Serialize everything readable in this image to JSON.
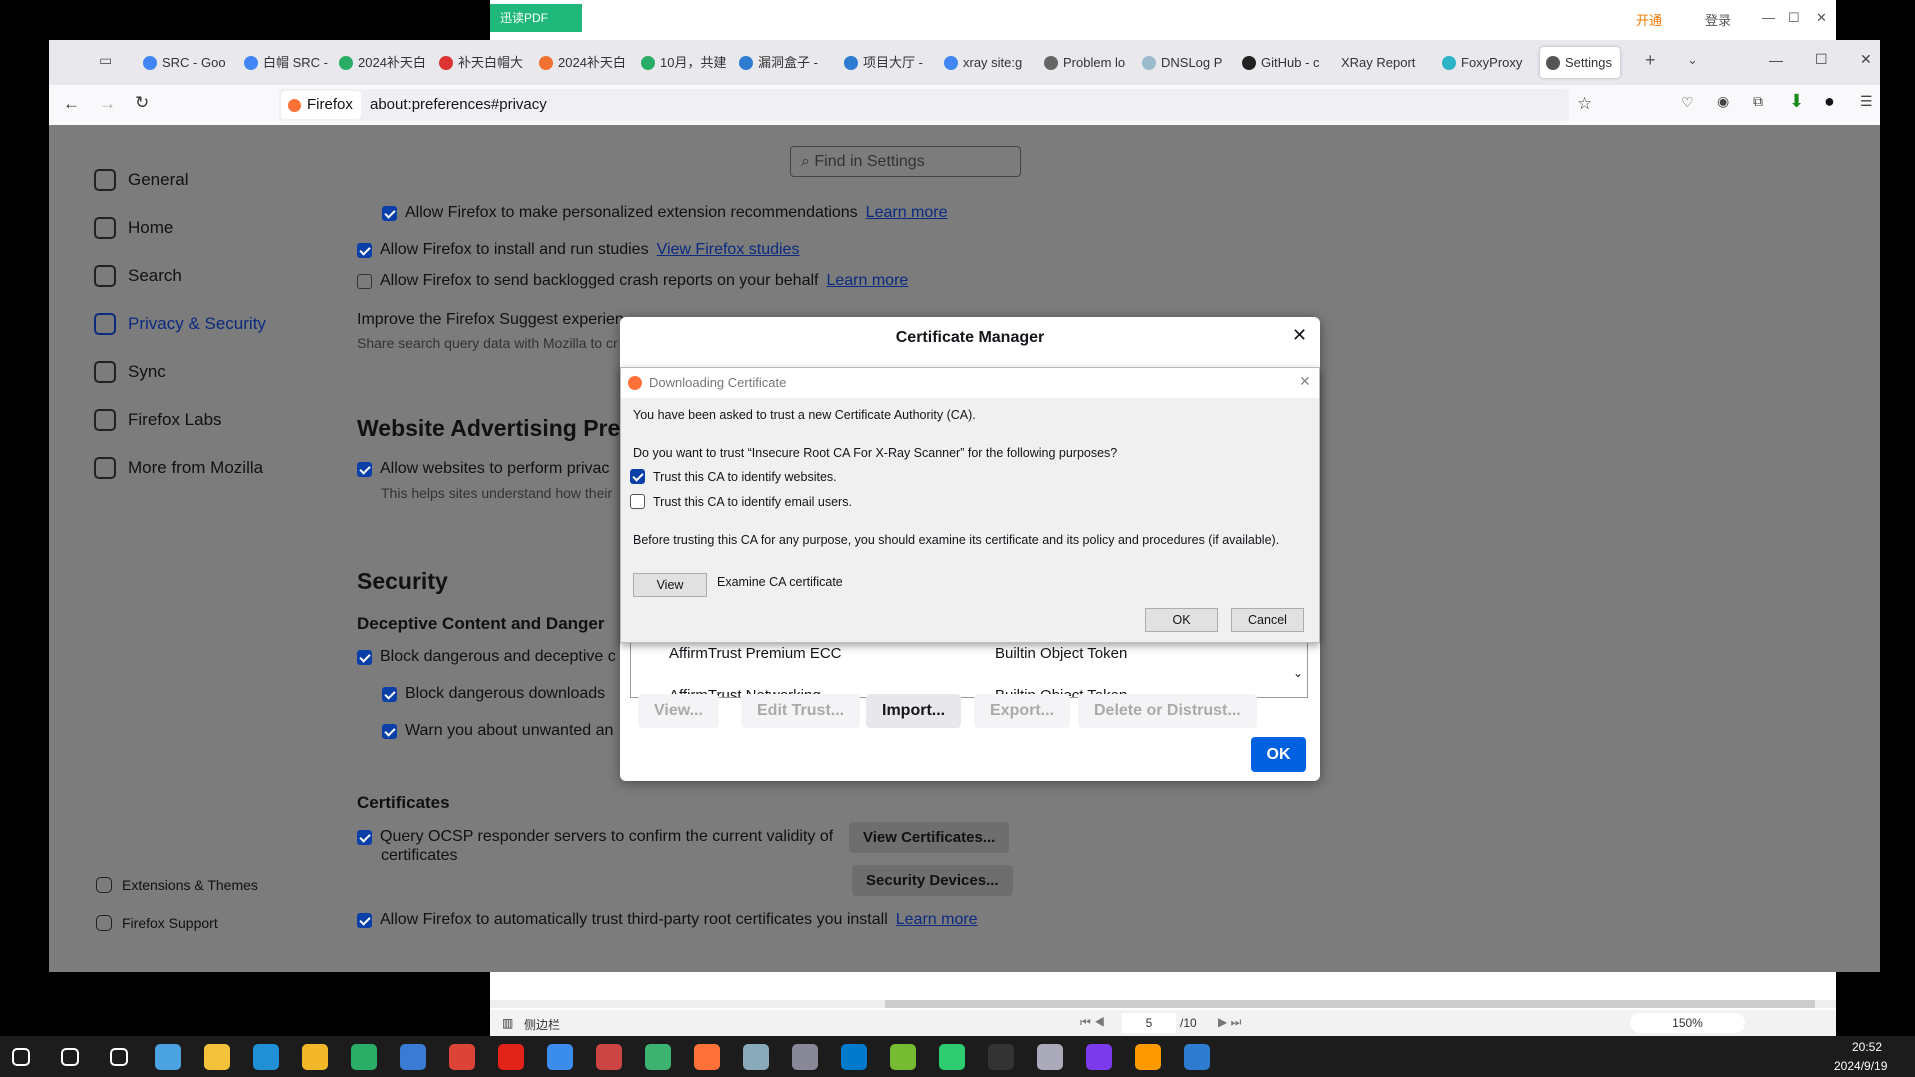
{
  "pdf_app": {
    "badge": "迅读PDF",
    "vip": "开通",
    "login": "登录",
    "sidebar_label": "侧边栏",
    "page_current": "5",
    "page_total": "/10",
    "zoom": "150%"
  },
  "browser": {
    "tabs": [
      {
        "label": "SRC - Goo",
        "icon": "google-icon",
        "color": "#4285f4"
      },
      {
        "label": "白帽 SRC -",
        "icon": "google-icon",
        "color": "#4285f4"
      },
      {
        "label": "2024补天白",
        "icon": "wechat-icon",
        "color": "#2aae67"
      },
      {
        "label": "补天白帽大",
        "icon": "star-icon",
        "color": "#d33"
      },
      {
        "label": "2024补天白",
        "icon": "app-icon",
        "color": "#f07030"
      },
      {
        "label": "10月，共建",
        "icon": "wechat-icon",
        "color": "#2aae67"
      },
      {
        "label": "漏洞盒子 -",
        "icon": "shield-icon",
        "color": "#2d7cd1"
      },
      {
        "label": "项目大厅 -",
        "icon": "shield-icon",
        "color": "#2d7cd1"
      },
      {
        "label": "xray site:g",
        "icon": "google-icon",
        "color": "#4285f4"
      },
      {
        "label": "Problem lo",
        "icon": "info-icon",
        "color": "#666"
      },
      {
        "label": "DNSLog P",
        "icon": "page-icon",
        "color": "#9bc"
      },
      {
        "label": "GitHub - c",
        "icon": "github-icon",
        "color": "#222"
      },
      {
        "label": "XRay Report",
        "icon": "",
        "color": ""
      },
      {
        "label": "FoxyProxy",
        "icon": "fox-icon",
        "color": "#2cb3c8"
      },
      {
        "label": "Settings",
        "icon": "gear-icon",
        "color": "#555",
        "active": true
      }
    ],
    "identity": "Firefox",
    "url": "about:preferences#privacy"
  },
  "settings": {
    "search_placeholder": "Find in Settings",
    "sidebar": [
      {
        "label": "General",
        "icon": "gear-icon"
      },
      {
        "label": "Home",
        "icon": "home-icon"
      },
      {
        "label": "Search",
        "icon": "search-icon"
      },
      {
        "label": "Privacy & Security",
        "icon": "lock-icon",
        "active": true
      },
      {
        "label": "Sync",
        "icon": "sync-icon"
      },
      {
        "label": "Firefox Labs",
        "icon": "labs-icon"
      },
      {
        "label": "More from Mozilla",
        "icon": "mozilla-icon"
      }
    ],
    "sidebar_footer": [
      {
        "label": "Extensions & Themes",
        "icon": "puzzle-icon"
      },
      {
        "label": "Firefox Support",
        "icon": "help-icon"
      }
    ],
    "opt_ext_rec": "Allow Firefox to make personalized extension recommendations",
    "learn_more": "Learn more",
    "opt_studies": "Allow Firefox to install and run studies",
    "view_studies": "View Firefox studies",
    "opt_crash": "Allow Firefox to send backlogged crash reports on your behalf",
    "suggest_title": "Improve the Firefox Suggest experien",
    "suggest_desc": "Share search query data with Mozilla to cr",
    "ad_heading": "Website Advertising Pre",
    "ad_opt": "Allow websites to perform privac",
    "ad_desc": "This helps sites understand how their",
    "security_heading": "Security",
    "deceptive_heading": "Deceptive Content and Danger",
    "block_dangerous": "Block dangerous and deceptive c",
    "block_downloads": "Block dangerous downloads",
    "warn_unwanted": "Warn you about unwanted an",
    "certs_heading": "Certificates",
    "ocsp": "Query OCSP responder servers to confirm the current validity of",
    "ocsp2": "certificates",
    "view_certs": "View Certificates...",
    "security_devices": "Security Devices...",
    "third_party": "Allow Firefox to automatically trust third-party root certificates you install"
  },
  "cert_manager": {
    "title": "Certificate Manager",
    "rows": [
      {
        "name": "AffirmTrust Premium ECC",
        "device": "Builtin Object Token"
      },
      {
        "name": "AffirmTrust Networking",
        "device": "Builtin Object Token"
      }
    ],
    "buttons": [
      "View...",
      "Edit Trust...",
      "Import...",
      "Export...",
      "Delete or Distrust..."
    ],
    "ok": "OK"
  },
  "download_dialog": {
    "title": "Downloading Certificate",
    "line1": "You have been asked to trust a new Certificate Authority (CA).",
    "question": "Do you want to trust “Insecure Root CA For X-Ray Scanner” for the following purposes?",
    "trust_websites": "Trust this CA to identify websites.",
    "trust_websites_checked": true,
    "trust_email": "Trust this CA to identify email users.",
    "trust_email_checked": false,
    "warning": "Before trusting this CA for any purpose, you should examine its certificate and its policy and procedures (if available).",
    "view": "View",
    "examine": "Examine CA certificate",
    "ok": "OK",
    "cancel": "Cancel"
  },
  "taskbar": {
    "time": "20:52",
    "date": "2024/9/19",
    "icons": [
      "start-icon",
      "search-icon",
      "task-view-icon",
      "app-icon",
      "file-explorer-icon",
      "edge-icon",
      "app-icon",
      "wechat-icon",
      "mail-icon",
      "chrome-icon",
      "app-icon",
      "app-icon",
      "app-icon",
      "app-icon",
      "firefox-icon",
      "app-icon",
      "app-icon",
      "vscode-icon",
      "app-icon",
      "pdf-icon",
      "terminal-icon",
      "app-icon",
      "app-icon",
      "app-icon",
      "app-icon"
    ],
    "colors": [
      "#fff",
      "#fff",
      "#fff",
      "#4aa3e0",
      "#f3c13a",
      "#1f8fd6",
      "#f3b82a",
      "#2aae67",
      "#3a7bd5",
      "#db4437",
      "#e2231a",
      "#3b8ded",
      "#c44",
      "#3cb371",
      "#ff7139",
      "#8ab",
      "#889",
      "#007acc",
      "#7b3",
      "#2ecc71",
      "#333",
      "#aab",
      "#7c3aed",
      "#f90",
      "#2d7cd1"
    ]
  }
}
